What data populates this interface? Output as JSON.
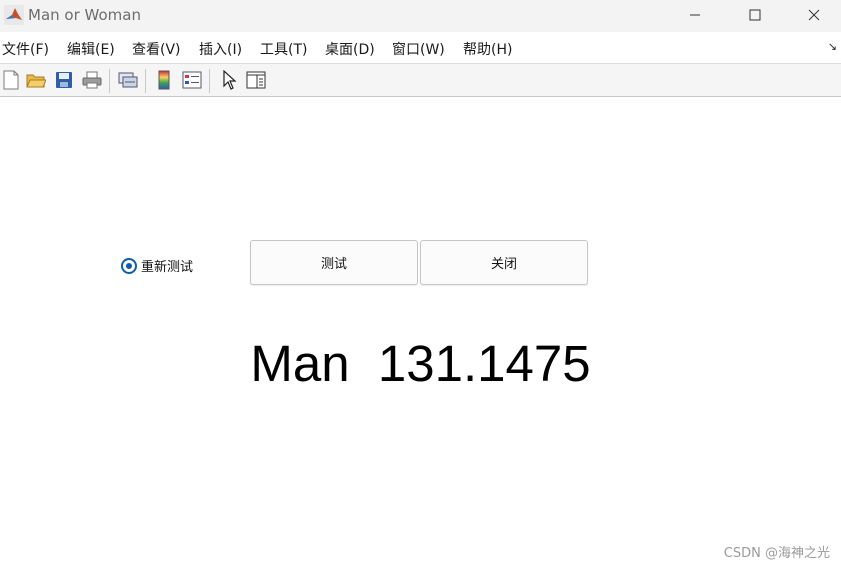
{
  "window": {
    "title": "Man or Woman"
  },
  "menu": [
    "文件(F)",
    "编辑(E)",
    "查看(V)",
    "插入(I)",
    "工具(T)",
    "桌面(D)",
    "窗口(W)",
    "帮助(H)"
  ],
  "toolbar": [
    "new-figure-icon",
    "open-folder-icon",
    "save-icon",
    "print-icon",
    "link-plot-icon",
    "colorbar-icon",
    "legend-icon",
    "pointer-icon",
    "property-editor-icon"
  ],
  "controls": {
    "radio_label": "重新测试",
    "radio_checked": true,
    "test_button": "测试",
    "close_button": "关闭"
  },
  "result": {
    "label": "Man",
    "value": "131.1475",
    "display": "Man  131.1475"
  },
  "watermark": "CSDN @海神之光",
  "colors": {
    "accent": "#0f5cab",
    "titlebar": "#f3f3f3",
    "toolbar": "#f5f5f5"
  }
}
